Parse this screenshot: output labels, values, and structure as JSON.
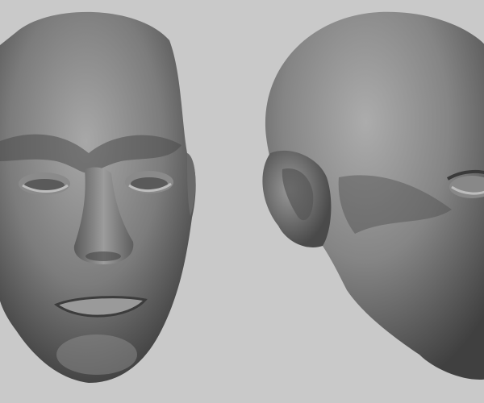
{
  "image": {
    "subject": "sculpt-render",
    "colors": {
      "background": "#c9c9c9",
      "skin_light": "#a9a9a9",
      "skin_mid": "#7a7a7a",
      "skin_dark": "#3e3e3e"
    }
  }
}
